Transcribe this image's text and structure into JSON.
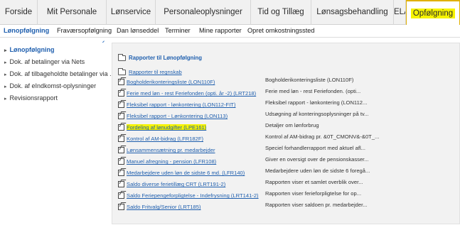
{
  "top_tabs": [
    {
      "label": "Forside"
    },
    {
      "label": "Mit Personale"
    },
    {
      "label": "Lønservice"
    },
    {
      "label": "Personaleoplysninger"
    },
    {
      "label": "Tid og Tillæg"
    },
    {
      "label": "Lønsagsbehandling"
    },
    {
      "label": "ELA Lønkontor"
    },
    {
      "label": "Opfølgning"
    }
  ],
  "sub_tabs": [
    {
      "label": "Lønopfølgning"
    },
    {
      "label": "Fraværsopfølgning"
    },
    {
      "label": "Dan lønseddel"
    },
    {
      "label": "Terminer"
    },
    {
      "label": "Mine rapporter"
    },
    {
      "label": "Opret omkostningssted"
    }
  ],
  "sidebar": {
    "items": [
      {
        "label": "Lønopfølgning"
      },
      {
        "label": "Dok. af betalinger via Nets"
      },
      {
        "label": "Dok. af tilbageholdte betalinger via ..."
      },
      {
        "label": "Dok. af eIndkomst-oplysninger"
      },
      {
        "label": "Revisionsrapport"
      }
    ]
  },
  "content": {
    "heading": "Rapporter til Lønopfølgning",
    "folder_link": "Rapporter til regnskab",
    "reports": [
      {
        "name": "Bogholderikonteringsliste (LON110F)",
        "desc": "Bogholderikonteringsliste (LON110F)"
      },
      {
        "name": "Ferie med løn - rest Feriefonden  (opti. år -2) (LRT218)",
        "desc": "Ferie med løn - rest Feriefonden. (opti..."
      },
      {
        "name": "Fleksibel rapport - lønkontering (LON112-FIT)",
        "desc": "Fleksibel rapport - lønkontering (LON112..."
      },
      {
        "name": "Fleksibel rapport - Lønkontering (LON113)",
        "desc": "Udsøgning af konteringsoplysninger på tv..."
      },
      {
        "name": "Fordeling af lønudgifter (LPE161)",
        "desc": "Detaljer om lønforbrug",
        "highlight": true
      },
      {
        "name": "Kontrol af AM-bidrag (LFR182F)",
        "desc": "Kontrol af AM-bidrag pr. &0T_CMONV&-&0T_..."
      },
      {
        "name": "Lønsammensætning pr. medarbejder",
        "desc": "Speciel forhandlerrapport med aktuel afl..."
      },
      {
        "name": "Manuel afregning - pension (LFR108)",
        "desc": "Giver en oversigt over de pensionskasser..."
      },
      {
        "name": "Medarbejdere uden løn de sidste 6 md. (LFR140)",
        "desc": "Medarbejdere uden løn de sidste 6 foregå..."
      },
      {
        "name": "Saldo diverse ferietillæg CRT (LRT191-2)",
        "desc": "Rapporten viser et samlet overblik over..."
      },
      {
        "name": "Saldo Feriepengeforpligtelse - Indefrysning (LRT141-2)",
        "desc": "Rapporten viser ferieforpligtelse for op..."
      },
      {
        "name": "Saldo Fritvalg/Senior (LRT185)",
        "desc": "Rapporten viser saldoen pr. medarbejder..."
      }
    ]
  },
  "colors": {
    "accent_link": "#1f5fae",
    "highlight": "#f6f300",
    "nav_bg": "#f1f1f1",
    "content_bg": "#f2f2f2"
  }
}
